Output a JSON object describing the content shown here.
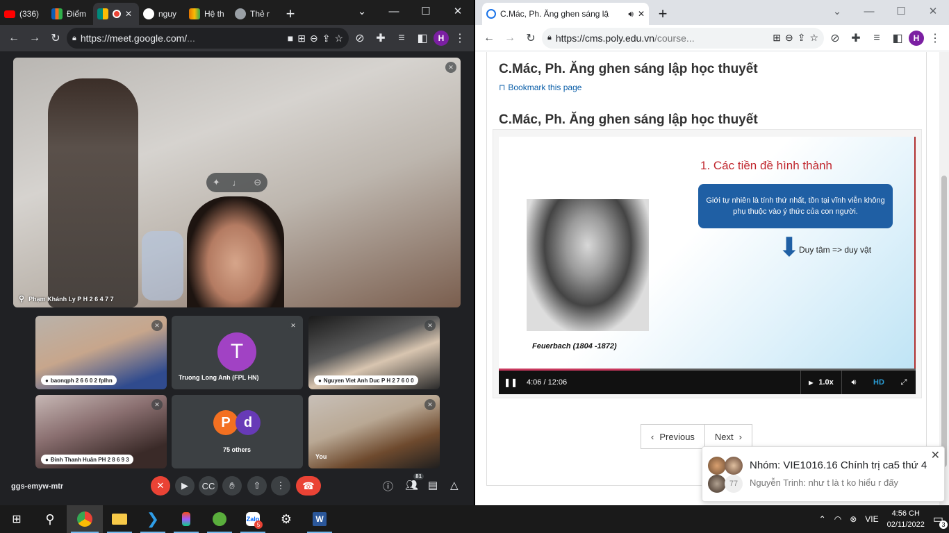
{
  "left_window": {
    "tabs": [
      {
        "label": "(336)",
        "icon": "youtube-icon",
        "color": "#ff0000"
      },
      {
        "label": "Điểm",
        "icon": "fpt-icon",
        "color": "#f37021"
      },
      {
        "label": "",
        "icon": "meet-icon",
        "color": "#00897b",
        "active": true
      },
      {
        "label": "nguy",
        "icon": "github-icon",
        "color": "#ffffff"
      },
      {
        "label": "Hệ th",
        "icon": "cms-icon",
        "color": "#e37400"
      },
      {
        "label": "Thẻ r",
        "icon": "chrome-icon",
        "color": "#9aa0a6"
      }
    ],
    "url_host": "https://meet.google.com/",
    "url_rest": "...",
    "profile_initial": "H"
  },
  "meet": {
    "main_participant": "Phạm Khánh Ly P H 2 6 4 7 7",
    "tiles": [
      {
        "name": "baonqph 2 6 6 0 2 fplhn",
        "type": "video"
      },
      {
        "name": "Truong Long Anh (FPL HN)",
        "type": "avatar",
        "initial": "T"
      },
      {
        "name": "Nguyen Viet Anh Duc P H 2 7 6 0 0",
        "type": "video"
      },
      {
        "name": "Đinh Thanh Huân PH 2 8 6 9 3",
        "type": "video"
      },
      {
        "name": "75 others",
        "type": "others",
        "initials": [
          "P",
          "d"
        ]
      },
      {
        "name": "You",
        "type": "video"
      }
    ],
    "meeting_code": "ggs-emyw-mtr",
    "people_count": "81"
  },
  "right_window": {
    "tab_title": "C.Mác, Ph. Ăng ghen sáng lậ",
    "url_host": "https://cms.poly.edu.vn",
    "url_rest": "/course...",
    "profile_initial": "H"
  },
  "course": {
    "heading": "C.Mác, Ph. Ăng ghen sáng lập học thuyết",
    "bookmark_label": "Bookmark this page",
    "video_heading": "C.Mác, Ph. Ăng ghen sáng lập học thuyết",
    "slide_title": "1. Các tiền đề hình thành",
    "slide_box": "Giới tự nhiên là tính thứ nhất, tồn tại vĩnh viễn không phụ thuộc vào ý thức của con người.",
    "slide_arrow_text": "Duy tâm => duy vật",
    "slide_caption": "Feuerbach (1804 -1872)",
    "time": "4:06 / 12:06",
    "progress_fraction": 0.339,
    "speed": "1.0x",
    "quality": "HD",
    "prev_label": "Previous",
    "next_label": "Next"
  },
  "notification": {
    "title": "Nhóm: VIE1016.16 Chính trị ca5 thứ 4",
    "message": "Nguyễn Trinh: như t là t ko hiểu r đấy",
    "count": "77"
  },
  "taskbar": {
    "lang": "VIE",
    "time": "4:56 CH",
    "date": "02/11/2022",
    "notif_count": "3",
    "zalo_badge": "5"
  }
}
